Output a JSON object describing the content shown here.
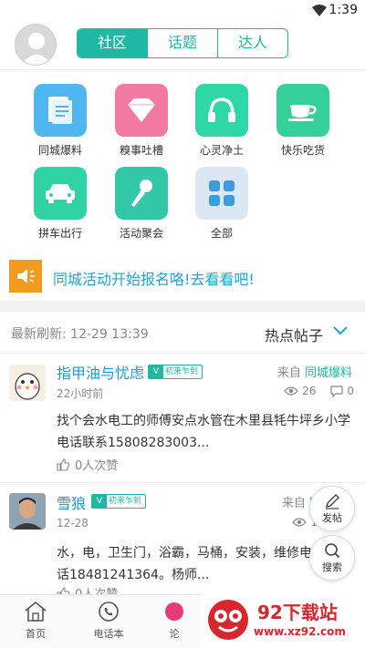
{
  "status_bar": {
    "time": "1:39"
  },
  "header": {
    "tabs": [
      "社区",
      "话题",
      "达人"
    ]
  },
  "categories": [
    {
      "label": "同城爆料",
      "icon": "document-icon",
      "color": "#4fb6f2"
    },
    {
      "label": "糗事吐槽",
      "icon": "diamond-icon",
      "color": "#f27aa0"
    },
    {
      "label": "心灵净土",
      "icon": "headphones-icon",
      "color": "#2fd6a6"
    },
    {
      "label": "快乐吃货",
      "icon": "teacup-icon",
      "color": "#35d09a"
    },
    {
      "label": "拼车出行",
      "icon": "car-icon",
      "color": "#2fd3a4"
    },
    {
      "label": "活动聚会",
      "icon": "microphone-icon",
      "color": "#33c9a8"
    },
    {
      "label": "全部",
      "icon": "grid-icon",
      "color": "#dbe7f2"
    }
  ],
  "notice": {
    "text": "同城活动开始报名咯!去看看吧!"
  },
  "refresh": {
    "label": "最新刷新:",
    "time": "12-29 13:39",
    "hot_label": "热点帖子"
  },
  "posts": [
    {
      "name": "指甲油与忧虑",
      "badge": "初来乍到",
      "time": "22小时前",
      "from_prefix": "来自",
      "from_category": "同城爆料",
      "views": "26",
      "comments": "0",
      "body": "找个会水电工的师傅安点水管在木里县牦牛坪乡小学电话联系15808283003...",
      "likes": "0人次赞"
    },
    {
      "name": "雪狼",
      "badge": "初来乍到",
      "time": "12-28",
      "from_prefix": "来自",
      "from_category": "同",
      "views": "1",
      "body": "水，电，卫生门，浴霸，马桶，安装，维修电话18481241364。杨师...",
      "likes": "0人次赞"
    }
  ],
  "floating": {
    "post_label": "发帖",
    "search_label": "搜索"
  },
  "tabbar": {
    "home": "首页",
    "phonebook": "电话本",
    "forum": "论"
  },
  "watermark": {
    "title": "92下载站",
    "url": "www.xz92.com"
  }
}
